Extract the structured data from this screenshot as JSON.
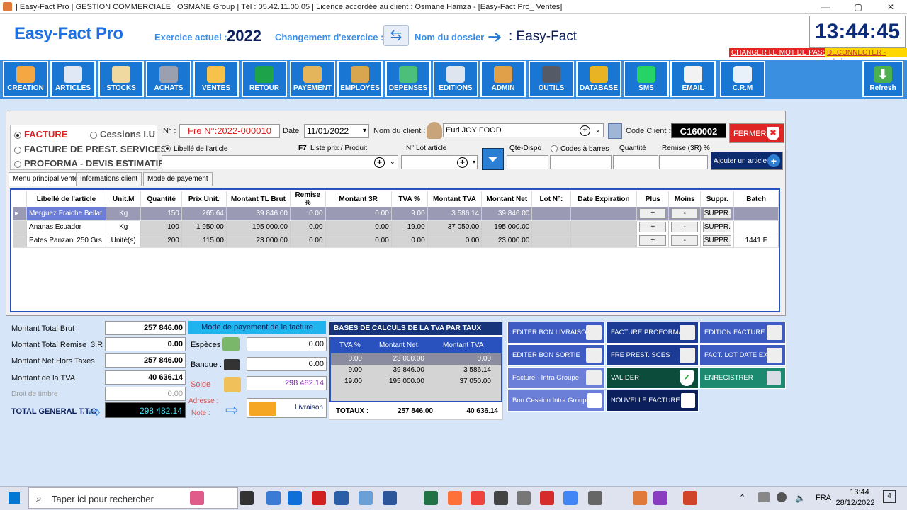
{
  "window": {
    "title": "| Easy-Fact Pro | GESTION COMMERCIALE | OSMANE Group | Tél : 05.42.11.00.05 | Licence accordée au client : Osmane Hamza - [Easy-Fact Pro_ Ventes]",
    "min": "—",
    "max": "▢",
    "close": "✕"
  },
  "header": {
    "logo": "Easy-Fact Pro",
    "exercice_label": "Exercice actuel :",
    "exercice_value": "2022",
    "changement_label": "Changement d'exercice :",
    "dossier_label": "Nom du dossier",
    "dossier_value": ": Easy-Fact",
    "clock": "13:44:45",
    "change_password": "CHANGER LE MOT DE PASSE",
    "disconnect": "DECONNECTER - admin"
  },
  "toolbar": [
    {
      "label": "CREATION",
      "color": "#f5a742"
    },
    {
      "label": "ARTICLES",
      "color": "#e0e8f5"
    },
    {
      "label": "STOCKS",
      "color": "#f0d9a0"
    },
    {
      "label": "ACHATS",
      "color": "#9aa0b0"
    },
    {
      "label": "VENTES",
      "color": "#f7c24a"
    },
    {
      "label": "RETOUR",
      "color": "#1da34a"
    },
    {
      "label": "PAYEMENT",
      "color": "#e4b55a"
    },
    {
      "label": "EMPLOYÉS",
      "color": "#d9a650"
    },
    {
      "label": "DEPENSES",
      "color": "#4cbf7a"
    },
    {
      "label": "EDITIONS",
      "color": "#dfe5ef"
    },
    {
      "label": "ADMIN",
      "color": "#e0a04a"
    },
    {
      "label": "OUTILS",
      "color": "#555b66"
    },
    {
      "label": "DATABASE",
      "color": "#e8b423"
    },
    {
      "label": "SMS",
      "color": "#25d366"
    },
    {
      "label": "EMAIL",
      "color": "#f2f2f2"
    },
    {
      "label": "C.R.M",
      "color": "#e8f0fa"
    }
  ],
  "refresh_label": "Refresh",
  "doc": {
    "facture": "FACTURE",
    "cessions": "Cessions  I.U",
    "facture_prest": "FACTURE DE PREST. SERVICES",
    "proforma": "PROFORMA - DEVIS ESTIMATIF",
    "num_label": "N° :",
    "num_value": "Fre N°:2022-000010",
    "date_label": "Date",
    "date_value": "11/01/2022",
    "client_label": "Nom du client :",
    "client_value": "Eurl JOY FOOD",
    "code_client_label": "Code Client :",
    "code_client_value": "C160002",
    "fermer": "FERMER",
    "libelle_radio": "Libellé de l'article",
    "f7_label": "F7",
    "liste_prix": "Liste prix / Produit",
    "lot_label": "N° Lot  article",
    "qte_dispo": "Qté-Dispo",
    "codes_barres": "Codes à barres",
    "quantite": "Quantité",
    "remise": "Remise (3R) %",
    "ajouter": "Ajouter un article"
  },
  "tabs": [
    "Menu principal ventes",
    "Informations client",
    "Mode de payement"
  ],
  "grid": {
    "headers": [
      "Libellé de l'article",
      "Unit.M",
      "Quantité",
      "Prix Unit.",
      "Montant TL Brut",
      "Remise %",
      "Montant 3R",
      "TVA %",
      "Montant TVA",
      "Montant Net",
      "Lot N°:",
      "Date Expiration",
      "Plus",
      "Moins",
      "Suppr.",
      "Batch"
    ],
    "rows": [
      [
        "Merguez Fraiche Bellat",
        "Kg",
        "150",
        "265.64",
        "39 846.00",
        "0.00",
        "0.00",
        "9.00",
        "3 586.14",
        "39 846.00",
        "",
        "",
        "+",
        "-",
        "SUPPR.",
        ""
      ],
      [
        "Ananas Ecuador",
        "Kg",
        "100",
        "1 950.00",
        "195 000.00",
        "0.00",
        "0.00",
        "19.00",
        "37 050.00",
        "195 000.00",
        "",
        "",
        "+",
        "-",
        "SUPPR.",
        ""
      ],
      [
        "Pates Panzani 250 Grs",
        "Unité(s)",
        "200",
        "115.00",
        "23 000.00",
        "0.00",
        "0.00",
        "0.00",
        "0.00",
        "23 000.00",
        "",
        "",
        "+",
        "-",
        "SUPPR.",
        "1441 F"
      ]
    ]
  },
  "totals": {
    "brut_label": "Montant Total Brut",
    "brut": "257 846.00",
    "remise_label": "Montant Total Remise",
    "remise_3r": "3.R",
    "remise": "0.00",
    "ht_label": "Montant Net Hors Taxes",
    "ht": "257 846.00",
    "tva_label": "Montant de la TVA",
    "tva": "40 636.14",
    "timbre_label": "Droit de timbre",
    "timbre": "0.00",
    "ttc_label": "TOTAL GENERAL T.T.C",
    "ttc": "298 482.14"
  },
  "payment": {
    "title": "Mode de payement de la facture",
    "especes_label": "Espèces",
    "especes": "0.00",
    "banque_label": "Banque :",
    "banque": "0.00",
    "solde_label": "Solde",
    "solde": "298 482.14",
    "adresse_label": "Adresse :",
    "note_label": "Note :",
    "livraison": "Livraison"
  },
  "tva_table": {
    "title": "BASES  DE  CALCULS  DE  LA  TVA  PAR  TAUX",
    "headers": [
      "TVA  %",
      "Montant  Net",
      "Montant  TVA"
    ],
    "rows": [
      [
        "0.00",
        "23 000.00",
        "0.00"
      ],
      [
        "9.00",
        "39 846.00",
        "3 586.14"
      ],
      [
        "19.00",
        "195 000.00",
        "37 050.00"
      ]
    ],
    "totaux_label": "TOTAUX :",
    "tot_net": "257 846.00",
    "tot_tva": "40 636.14"
  },
  "actions": {
    "bon_livraison": "EDITER BON LIVRAISON",
    "bon_sortie": "EDITER  BON  SORTIE",
    "intra_groupe": "Facture - Intra Groupe",
    "bon_cession": "Bon Cession Intra Groupe",
    "proforma": "FACTURE PROFORMA",
    "prest": "FRE  PREST. SCES",
    "valider": "VALIDER",
    "nouvelle": "NOUVELLE FACTURE",
    "edition": "EDITION FACTURE",
    "lot_date": "FACT. LOT DATE EXP.",
    "enregistrer": "ENREGISTRER"
  },
  "taskbar": {
    "search": "Taper ici pour rechercher",
    "lang": "FRA",
    "time": "13:44",
    "date": "28/12/2022",
    "notif": "4"
  }
}
